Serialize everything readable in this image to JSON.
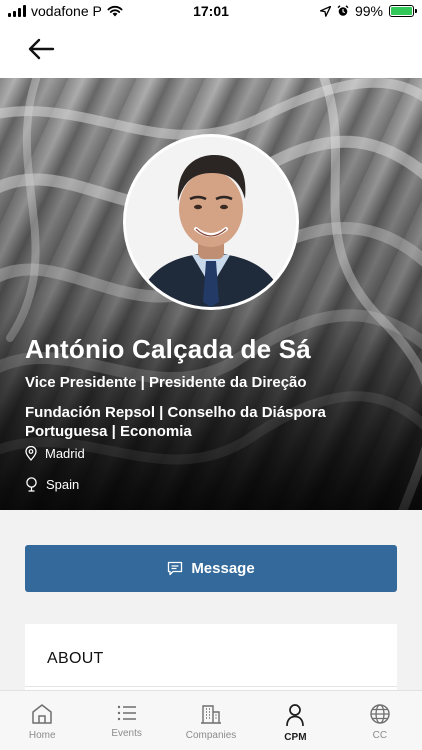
{
  "status_bar": {
    "carrier": "vodafone P",
    "time": "17:01",
    "battery": "99%",
    "battery_level": 0.99,
    "icons": [
      "signal-icon",
      "wifi-icon",
      "location-icon",
      "alarm-icon",
      "battery-icon"
    ]
  },
  "nav": {
    "back_icon": "arrow-left-icon"
  },
  "profile": {
    "name": "António Calçada de Sá",
    "title": "Vice Presidente | Presidente da Direção",
    "organizations": "Fundación Repsol | Conselho da Diáspora Portuguesa | Economia",
    "city": "Madrid",
    "country": "Spain"
  },
  "actions": {
    "message_label": "Message",
    "message_icon": "message-icon",
    "message_color": "#336a9b"
  },
  "about": {
    "title": "ABOUT"
  },
  "tabs": [
    {
      "label": "Home",
      "icon": "home-icon"
    },
    {
      "label": "Events",
      "icon": "list-icon"
    },
    {
      "label": "Companies",
      "icon": "building-icon"
    },
    {
      "label": "CPM",
      "icon": "person-icon",
      "active": true
    },
    {
      "label": "CC",
      "icon": "globe-icon"
    }
  ]
}
